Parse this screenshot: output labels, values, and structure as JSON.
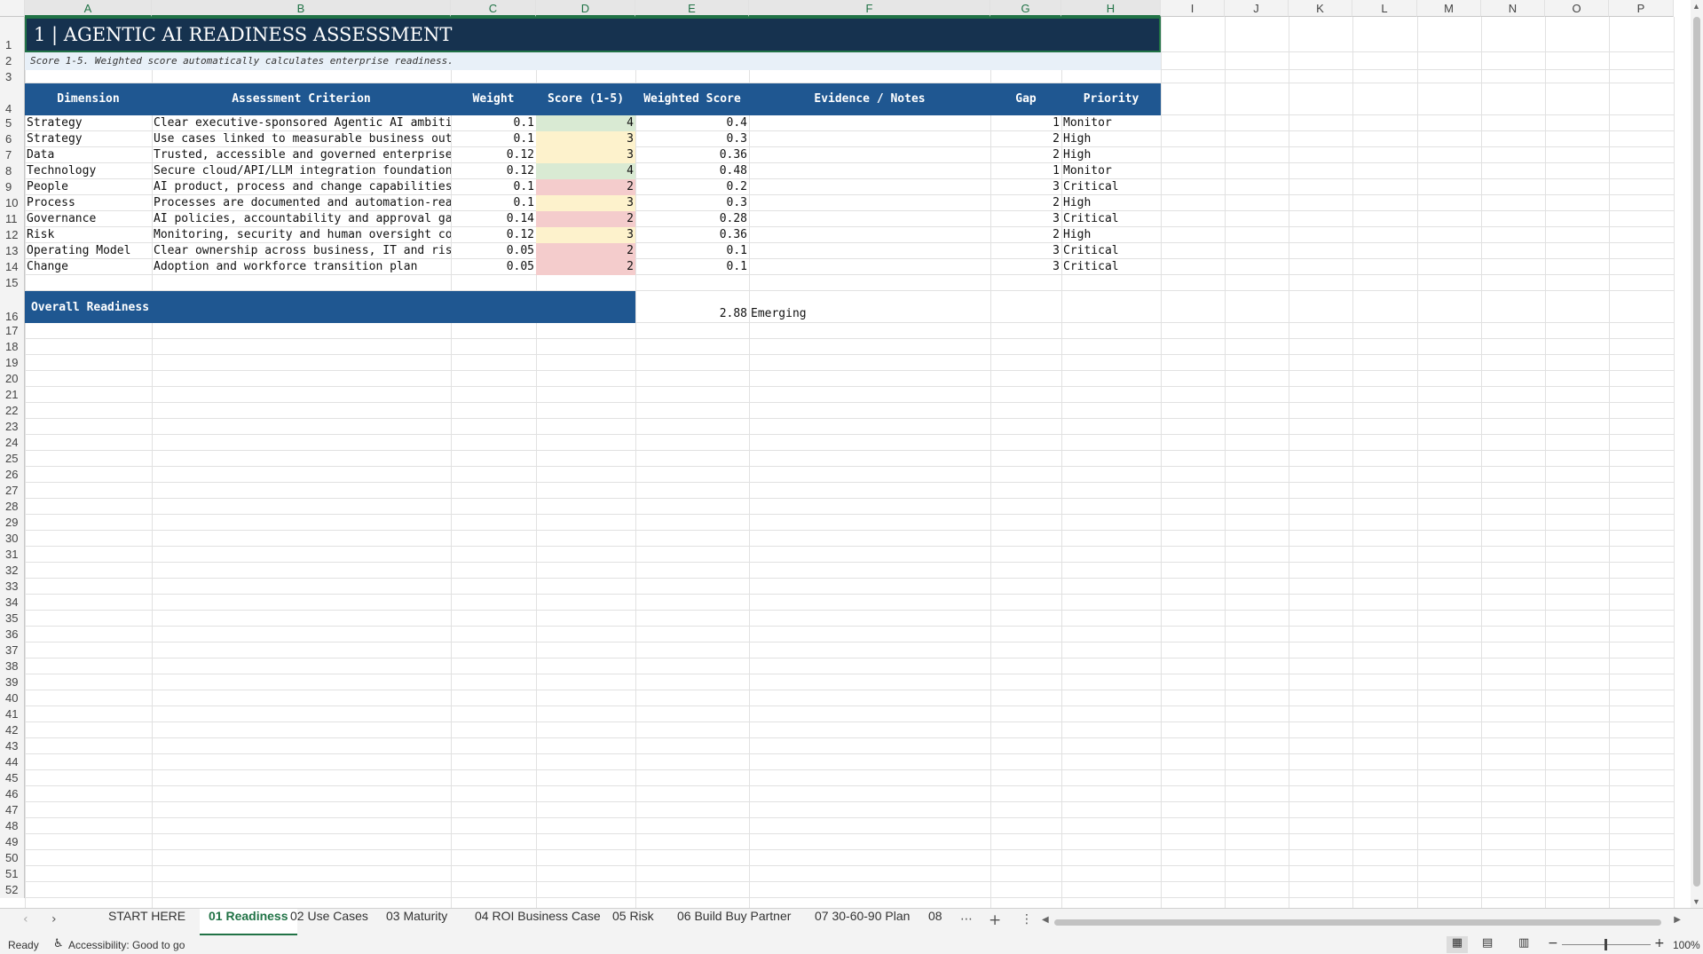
{
  "columns": [
    "A",
    "B",
    "C",
    "D",
    "E",
    "F",
    "G",
    "H",
    "I",
    "J",
    "K",
    "L",
    "M",
    "N",
    "O",
    "P"
  ],
  "selected_columns": [
    "A",
    "B",
    "C",
    "D",
    "E",
    "F",
    "G",
    "H"
  ],
  "title": "1 | AGENTIC AI READINESS ASSESSMENT",
  "subtitle": "Score 1-5. Weighted score automatically calculates enterprise readiness.",
  "headers": {
    "dimension": "Dimension",
    "criterion": "Assessment Criterion",
    "weight": "Weight",
    "score": "Score (1-5)",
    "weighted": "Weighted Score",
    "evidence": "Evidence / Notes",
    "gap": "Gap",
    "priority": "Priority"
  },
  "rows": [
    {
      "dimension": "Strategy",
      "criterion": "Clear executive-sponsored Agentic AI ambition",
      "weight": "0.1",
      "score": "4",
      "weighted": "0.4",
      "gap": "1",
      "priority": "Monitor",
      "score_color": "g"
    },
    {
      "dimension": "Strategy",
      "criterion": "Use cases linked to measurable business outcomes",
      "weight": "0.1",
      "score": "3",
      "weighted": "0.3",
      "gap": "2",
      "priority": "High",
      "score_color": "y"
    },
    {
      "dimension": "Data",
      "criterion": "Trusted, accessible and governed enterprise data",
      "weight": "0.12",
      "score": "3",
      "weighted": "0.36",
      "gap": "2",
      "priority": "High",
      "score_color": "y"
    },
    {
      "dimension": "Technology",
      "criterion": "Secure cloud/API/LLM integration foundations",
      "weight": "0.12",
      "score": "4",
      "weighted": "0.48",
      "gap": "1",
      "priority": "Monitor",
      "score_color": "g"
    },
    {
      "dimension": "People",
      "criterion": "AI product, process and change capabilities",
      "weight": "0.1",
      "score": "2",
      "weighted": "0.2",
      "gap": "3",
      "priority": "Critical",
      "score_color": "r"
    },
    {
      "dimension": "Process",
      "criterion": "Processes are documented and automation-ready",
      "weight": "0.1",
      "score": "3",
      "weighted": "0.3",
      "gap": "2",
      "priority": "High",
      "score_color": "y"
    },
    {
      "dimension": "Governance",
      "criterion": "AI policies, accountability and approval gates",
      "weight": "0.14",
      "score": "2",
      "weighted": "0.28",
      "gap": "3",
      "priority": "Critical",
      "score_color": "r"
    },
    {
      "dimension": "Risk",
      "criterion": "Monitoring, security and human oversight controls",
      "weight": "0.12",
      "score": "3",
      "weighted": "0.36",
      "gap": "2",
      "priority": "High",
      "score_color": "y"
    },
    {
      "dimension": "Operating Model",
      "criterion": "Clear ownership across business, IT and risk",
      "weight": "0.05",
      "score": "2",
      "weighted": "0.1",
      "gap": "3",
      "priority": "Critical",
      "score_color": "r"
    },
    {
      "dimension": "Change",
      "criterion": "Adoption and workforce transition plan",
      "weight": "0.05",
      "score": "2",
      "weighted": "0.1",
      "gap": "3",
      "priority": "Critical",
      "score_color": "r"
    }
  ],
  "overall": {
    "label": "Overall Readiness",
    "score": "2.88",
    "level": "Emerging"
  },
  "tabs": [
    "START HERE",
    "01 Readiness",
    "02 Use Cases",
    "03 Maturity",
    "04 ROI Business Case",
    "05 Risk",
    "06 Build Buy Partner",
    "07 30-60-90 Plan",
    "08"
  ],
  "active_tab": "01 Readiness",
  "status": {
    "ready": "Ready",
    "accessibility": "Accessibility: Good to go",
    "zoom": "100%"
  },
  "icons": {
    "prev": "chevron-left-icon",
    "next": "chevron-right-icon",
    "more": "more-icon",
    "add": "plus-icon",
    "menu": "vertical-dots-icon"
  }
}
